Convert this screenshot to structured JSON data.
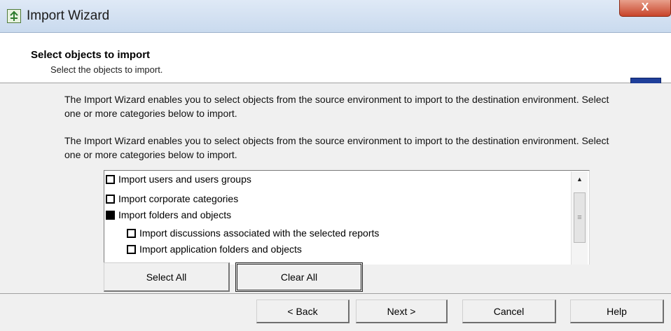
{
  "window": {
    "title": "Import Wizard",
    "close_label": "X"
  },
  "header": {
    "title": "Select objects to import",
    "subtitle": "Select the objects to import."
  },
  "content": {
    "description_1": "The Import Wizard enables you to select objects from the source environment to import to the destination environment. Select one or more categories below to import.",
    "description_2": "The Import Wizard enables you to select objects from the source environment to import to the destination environment. Select one or more categories below to import."
  },
  "list": {
    "items": [
      {
        "label": "Import users and users groups",
        "checked": false
      },
      {
        "label": "Import corporate categories",
        "checked": false
      },
      {
        "label": "Import folders and objects",
        "checked": true
      },
      {
        "label": "Import discussions associated with the selected reports",
        "checked": false
      },
      {
        "label": "Import application folders and objects",
        "checked": false
      }
    ]
  },
  "buttons": {
    "select_all": "Select All",
    "clear_all": "Clear All",
    "back": "< Back",
    "next": "Next >",
    "cancel": "Cancel",
    "help": "Help"
  },
  "colors": {
    "titlebar": "#c9daee",
    "close_button": "#c8442a",
    "header_icon": "#1f3f9a"
  }
}
